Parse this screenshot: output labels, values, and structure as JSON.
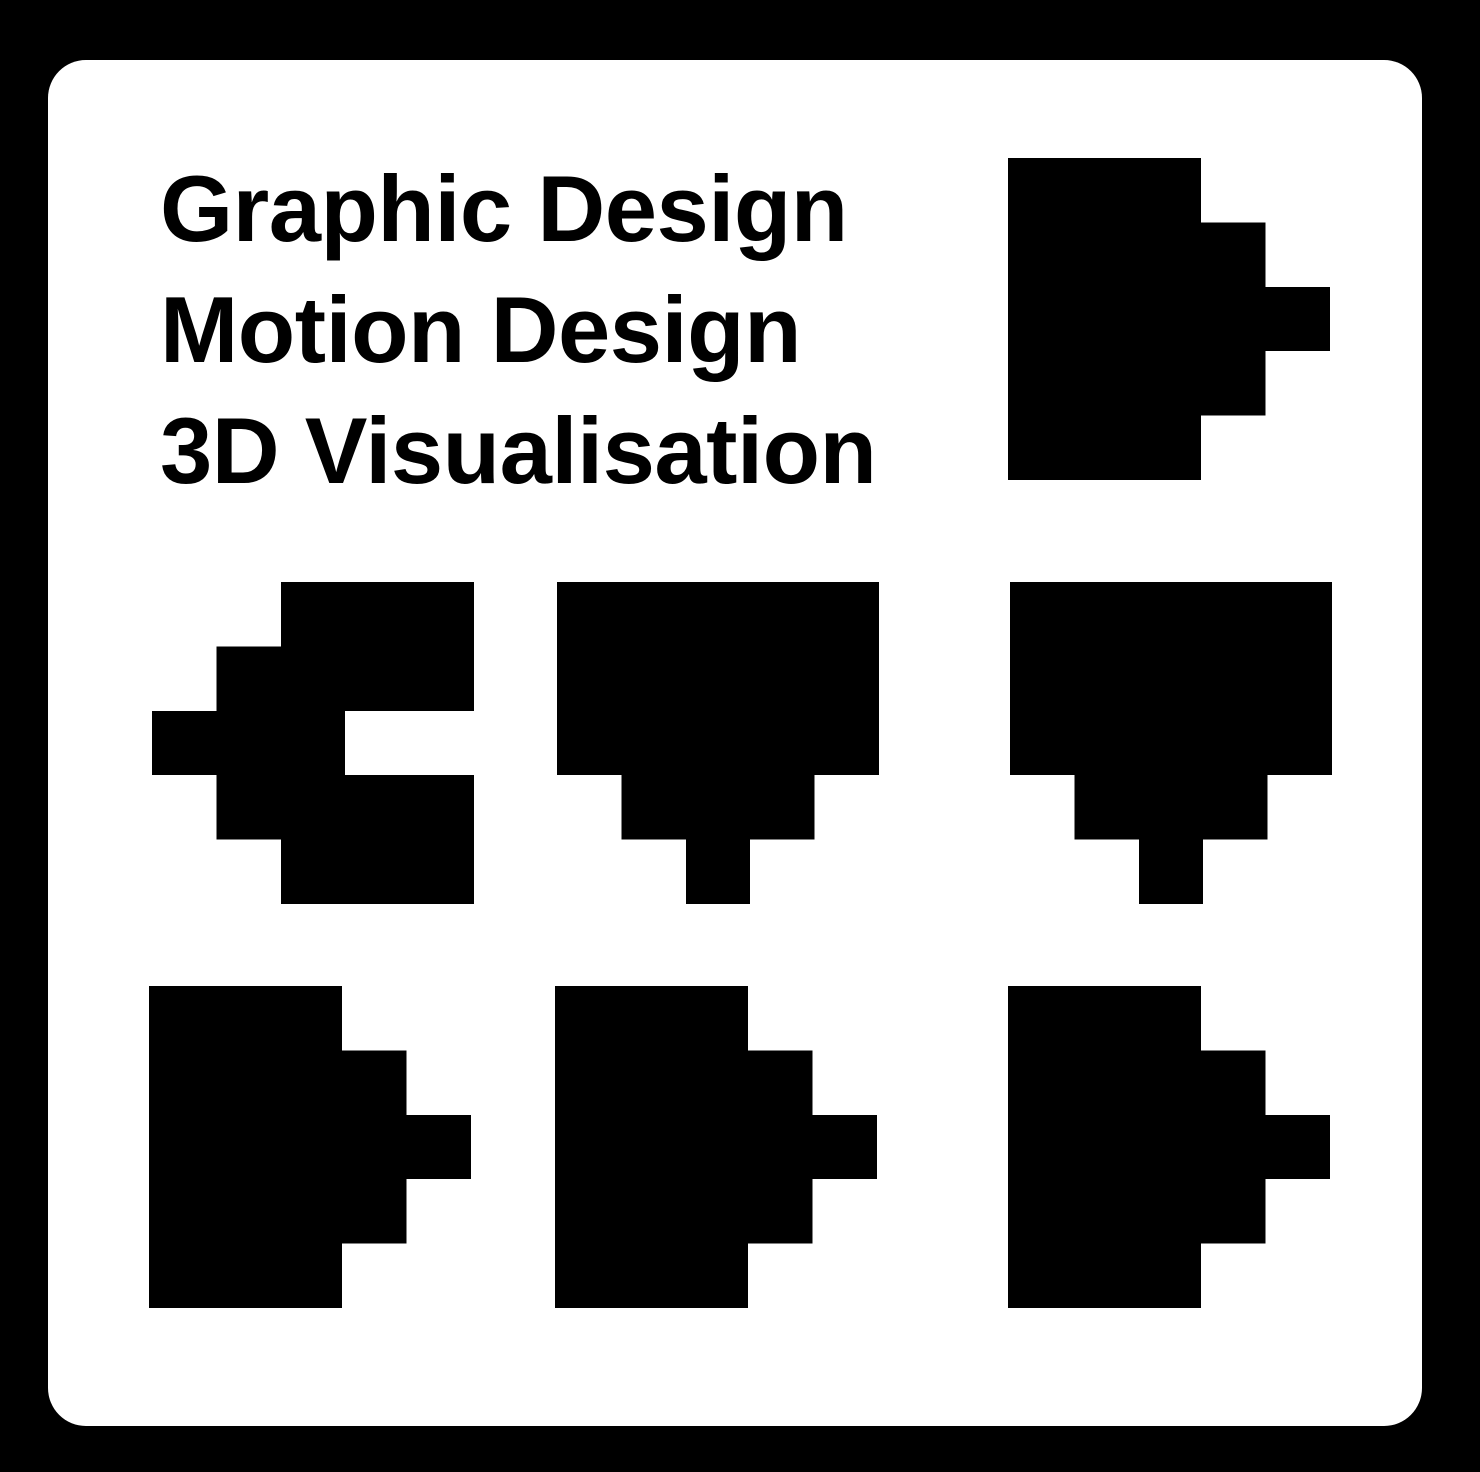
{
  "logo": {
    "services": [
      "Graphic Design",
      "Motion Design",
      "3D Visualisation"
    ],
    "colors": {
      "background": "#000000",
      "card": "#ffffff",
      "mark": "#000000"
    },
    "glyphs": [
      {
        "name": "arrow-right-icon",
        "direction": "right"
      },
      {
        "name": "arrow-left-notched-icon",
        "direction": "left-notched"
      },
      {
        "name": "arrow-down-icon",
        "direction": "down"
      },
      {
        "name": "arrow-down-icon",
        "direction": "down"
      },
      {
        "name": "arrow-right-icon",
        "direction": "right"
      },
      {
        "name": "arrow-right-icon",
        "direction": "right"
      },
      {
        "name": "arrow-right-icon",
        "direction": "right"
      }
    ]
  }
}
